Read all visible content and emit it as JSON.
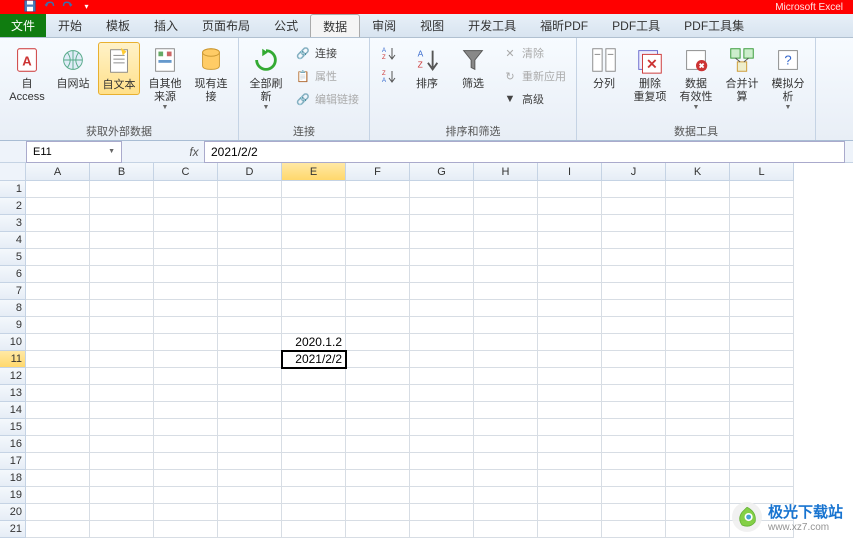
{
  "title_suffix": "Microsoft Excel",
  "qat": {
    "save": "💾",
    "undo": "↶",
    "redo": "↷"
  },
  "tabs": {
    "file": "文件",
    "items": [
      "开始",
      "模板",
      "插入",
      "页面布局",
      "公式",
      "数据",
      "审阅",
      "视图",
      "开发工具",
      "福昕PDF",
      "PDF工具",
      "PDF工具集"
    ],
    "active": "数据"
  },
  "ribbon": {
    "group1": {
      "label": "获取外部数据",
      "access": "自 Access",
      "web": "自网站",
      "text": "自文本",
      "other": "自其他来源",
      "existing": "现有连接"
    },
    "group2": {
      "label": "连接",
      "refresh": "全部刷新",
      "conn": "连接",
      "props": "属性",
      "editlinks": "编辑链接"
    },
    "group3": {
      "label": "排序和筛选",
      "sortaz": "A→Z",
      "sortza": "Z→A",
      "sort": "排序",
      "filter": "筛选",
      "clear": "清除",
      "reapply": "重新应用",
      "advanced": "高级"
    },
    "group4": {
      "label": "数据工具",
      "texttocol": "分列",
      "removedup": "删除\n重复项",
      "validation": "数据\n有效性",
      "consolidate": "合并计算",
      "whatif": "模拟分析"
    }
  },
  "namebox": "E11",
  "fx": "fx",
  "formula": "2021/2/2",
  "columns": [
    "A",
    "B",
    "C",
    "D",
    "E",
    "F",
    "G",
    "H",
    "I",
    "J",
    "K",
    "L"
  ],
  "rows": 21,
  "active": {
    "row": 11,
    "col": "E"
  },
  "cell_e10": "2020.1.2",
  "cell_e11": "2021/2/2",
  "watermark": {
    "cn": "极光下载站",
    "url": "www.xz7.com"
  }
}
